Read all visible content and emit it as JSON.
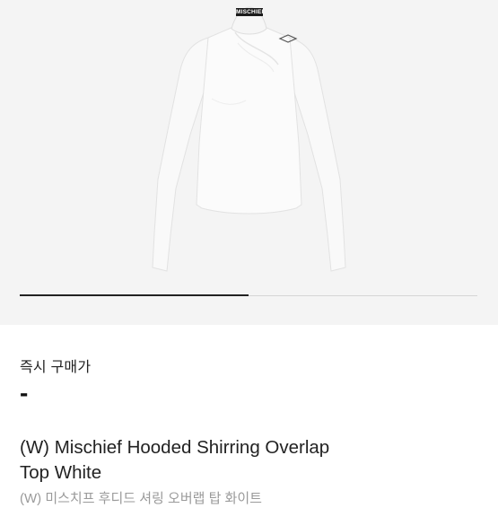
{
  "product_image": {
    "brand_tag": "MISCHIEF",
    "gallery_progress": 0.5
  },
  "purchase": {
    "label": "즉시 구매가",
    "price": "-"
  },
  "product": {
    "title": "(W) Mischief Hooded Shirring Overlap\nTop White",
    "subtitle": "(W) 미스치프 후디드 셔링 오버랩 탑 화이트"
  }
}
